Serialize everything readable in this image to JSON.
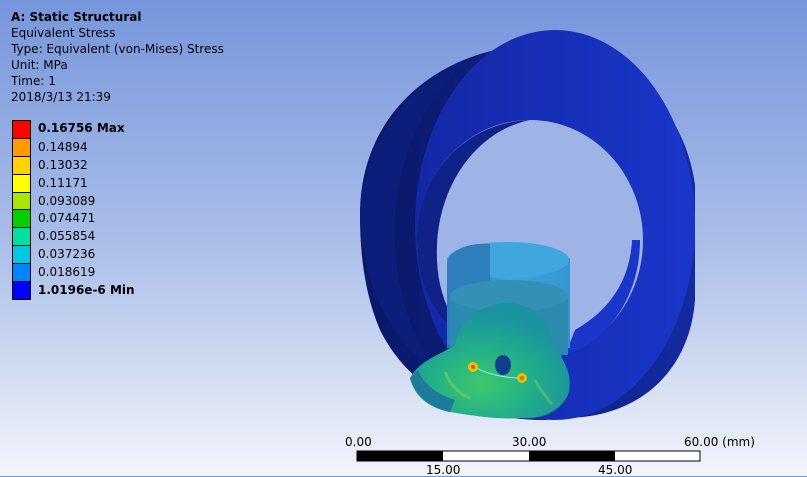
{
  "info": {
    "title": "A: Static Structural",
    "result": "Equivalent Stress",
    "type": "Type: Equivalent (von-Mises) Stress",
    "unit": "Unit: MPa",
    "time": "Time: 1",
    "date": "2018/3/13 21:39"
  },
  "legend": {
    "entries": [
      {
        "label": "0.16756 Max",
        "color": "#ff0000",
        "bold": true
      },
      {
        "label": "0.14894",
        "color": "#ff9a00",
        "bold": false
      },
      {
        "label": "0.13032",
        "color": "#ffd200",
        "bold": false
      },
      {
        "label": "0.11171",
        "color": "#ffff00",
        "bold": false
      },
      {
        "label": "0.093089",
        "color": "#a8e600",
        "bold": false
      },
      {
        "label": "0.074471",
        "color": "#00d000",
        "bold": false
      },
      {
        "label": "0.055854",
        "color": "#00e0a0",
        "bold": false
      },
      {
        "label": "0.037236",
        "color": "#00c8e0",
        "bold": false
      },
      {
        "label": "0.018619",
        "color": "#0084ff",
        "bold": false
      },
      {
        "label": "1.0196e-6 Min",
        "color": "#0000ff",
        "bold": true
      }
    ]
  },
  "scale": {
    "top_labels": [
      "0.00",
      "30.00",
      "60.00 (mm)"
    ],
    "bottom_labels": [
      "15.00",
      "45.00"
    ]
  },
  "colors": {
    "ring_dark": "#0a1a6e",
    "ring_mid": "#0f2aa8",
    "ring_face": "#1a35c8",
    "shaft_blue": "#3a9ad6",
    "hub_teal": "#2a86a8",
    "stress_green": "#1fae86"
  }
}
